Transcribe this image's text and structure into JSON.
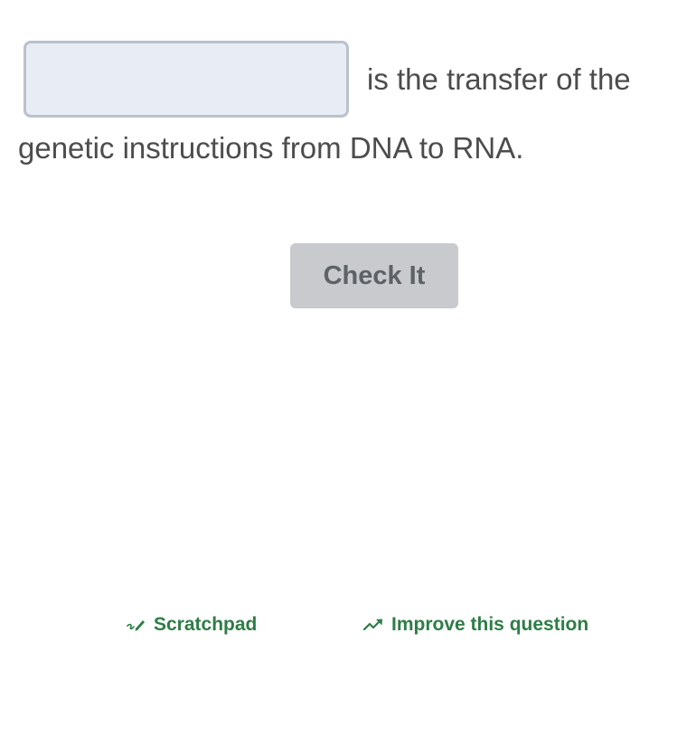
{
  "question": {
    "blank_value": "",
    "text_after_blank": "is the transfer of the",
    "text_line2": "genetic instructions from DNA to RNA."
  },
  "actions": {
    "check_label": "Check It"
  },
  "footer": {
    "scratchpad_label": "Scratchpad",
    "scratchpad_icon": "pencil-icon",
    "improve_label": "Improve this question",
    "improve_icon": "trend-arrow-icon"
  },
  "colors": {
    "link_green": "#2d7d46",
    "blank_fill": "#e8ecf4",
    "blank_border": "#b9c1cc",
    "button_disabled": "#c8cacd"
  }
}
